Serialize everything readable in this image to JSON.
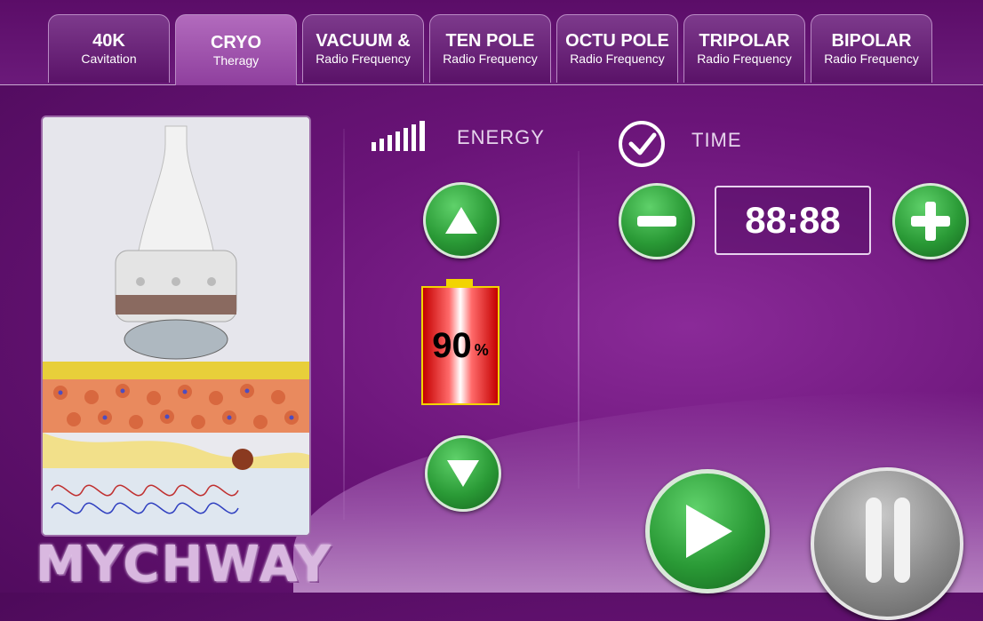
{
  "tabs": [
    {
      "title": "40K",
      "subtitle": "Cavitation",
      "active": false
    },
    {
      "title": "CRYO",
      "subtitle": "Theragy",
      "active": true
    },
    {
      "title": "VACUUM &",
      "subtitle": "Radio Frequency",
      "active": false
    },
    {
      "title": "TEN POLE",
      "subtitle": "Radio Frequency",
      "active": false
    },
    {
      "title": "OCTU POLE",
      "subtitle": "Radio Frequency",
      "active": false
    },
    {
      "title": "TRIPOLAR",
      "subtitle": "Radio Frequency",
      "active": false
    },
    {
      "title": "BIPOLAR",
      "subtitle": "Radio Frequency",
      "active": false
    }
  ],
  "brand": {
    "logo_text": "MYCHWAY"
  },
  "energy": {
    "label": "ENERGY",
    "battery_value": "90",
    "battery_unit": "%",
    "level": 0.9
  },
  "time": {
    "label": "TIME",
    "display": "88:88",
    "checked": true
  },
  "icons": {
    "energy": "signal-bars-icon",
    "time": "check-circle-icon",
    "up": "arrow-up-icon",
    "down": "arrow-down-icon",
    "minus": "minus-icon",
    "plus": "plus-icon",
    "play": "play-icon",
    "pause": "pause-icon"
  },
  "colors": {
    "accent_green": "#2a9a36",
    "battery_border": "#f2d400",
    "battery_fill": "#c40000",
    "background": "#6a1478"
  }
}
